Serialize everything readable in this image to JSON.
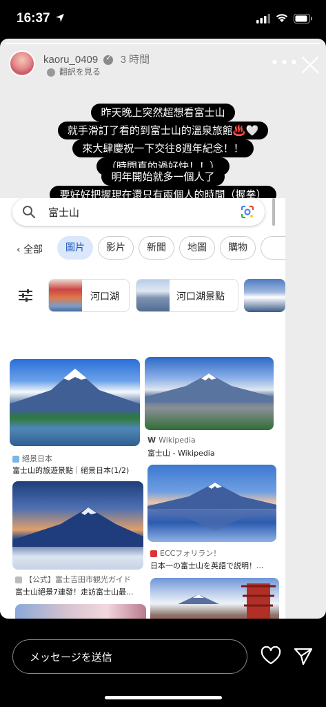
{
  "status": {
    "time": "16:37"
  },
  "story": {
    "username": "kaoru_0409",
    "time_ago": "3 時間",
    "translate": "翻訳を見る",
    "caption1": [
      "昨天晚上突然超想看富士山",
      "就手滑訂了看的到富士山的溫泉旅館♨️🤍",
      "來大肆慶祝一下交往8週年紀念！！",
      "（時間真的過好快！！）"
    ],
    "caption2": [
      "明年開始就多一個人了",
      "要好好把握現在還只有兩個人的時間（握拳）"
    ]
  },
  "google": {
    "query": "富士山",
    "tabs": [
      "圖片",
      "影片",
      "新聞",
      "地圖",
      "購物"
    ],
    "all_label": "全部",
    "chips": [
      "河口湖",
      "河口湖景點"
    ],
    "results": [
      {
        "source": "絕景日本",
        "title": "富士山的旅遊景點｜絕景日本(1/2)"
      },
      {
        "source": "Wikipedia",
        "title": "富士山 - Wikipedia"
      },
      {
        "source": "【公式】富士吉田市観光ガイド",
        "title": "富士山絕景7連發！走訪富士山最..."
      },
      {
        "source": "ECCフォリラン！",
        "title": "日本一の富士山を英語で説明！..."
      }
    ]
  },
  "footer": {
    "message_placeholder": "メッセージを送信"
  },
  "colors": {
    "tab_selected_bg": "#dbe7fb",
    "tab_selected_text": "#1a55b8"
  }
}
